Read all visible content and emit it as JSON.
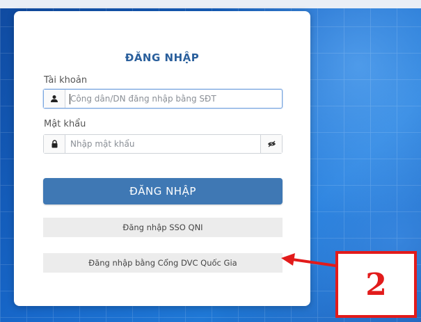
{
  "login": {
    "title": "ĐĂNG NHẬP",
    "username_label": "Tài khoản",
    "username_placeholder": "Công dân/DN đăng nhập bằng SĐT",
    "password_label": "Mật khẩu",
    "password_placeholder": "Nhập mật khẩu",
    "submit_label": "ĐĂNG NHẬP",
    "sso_label": "Đăng nhập SSO QNI",
    "national_portal_label": "Đăng nhập bằng Cổng DVC Quốc Gia"
  },
  "icons": {
    "user": "user-icon",
    "lock": "lock-icon",
    "eye": "eye-slash-icon",
    "arrow": "arrow-left-icon"
  },
  "annotation": {
    "callout_number": "2"
  },
  "colors": {
    "brand_blue": "#3f78b4",
    "title_blue": "#2a5f9c",
    "annotation_red": "#e21b1b",
    "background_blue": "#1767c9"
  }
}
